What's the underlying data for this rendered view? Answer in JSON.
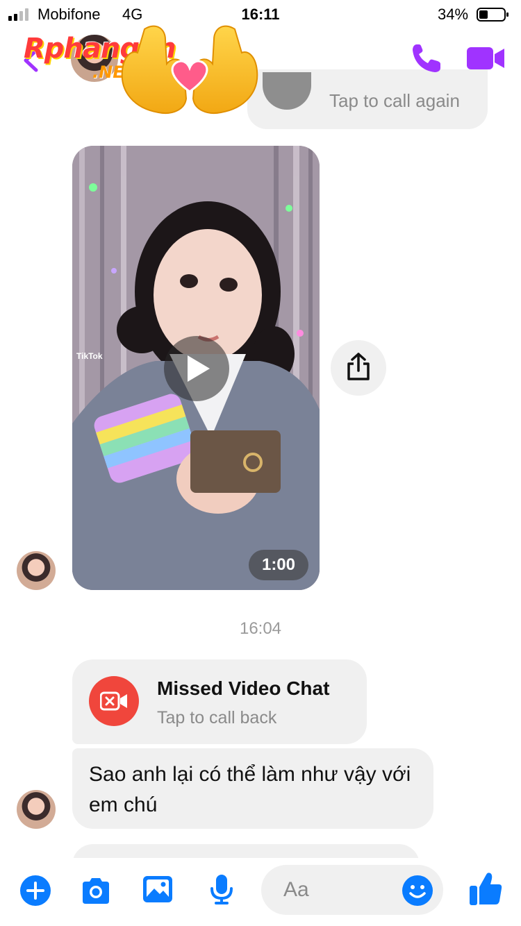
{
  "status_bar": {
    "carrier": "Mobifone",
    "network": "4G",
    "time": "16:11",
    "battery": "34%"
  },
  "header": {
    "watermark_text": "Rphangvn",
    "watermark_sub": ".NET",
    "icons": [
      "back-chevron-icon",
      "phone-icon",
      "video-camera-icon"
    ]
  },
  "prev_call": {
    "subtitle": "Tap to call again"
  },
  "video_message": {
    "tiktok_label": "TikTok",
    "duration": "1:00"
  },
  "timestamp": "16:04",
  "missed_call": {
    "title": "Missed Video Chat",
    "subtitle": "Tap to call back"
  },
  "text_message": {
    "body": "Sao anh lại có thể làm như vậy với em chú"
  },
  "composer": {
    "placeholder": "Aa",
    "icons": [
      "plus-icon",
      "camera-icon",
      "image-icon",
      "microphone-icon",
      "emoji-icon",
      "thumbs-up-icon"
    ]
  },
  "colors": {
    "accent": "#0a7cff",
    "header_icons": "#a033ff",
    "missed_red": "#f0463c",
    "bubble_gray": "#f0f0f0"
  }
}
